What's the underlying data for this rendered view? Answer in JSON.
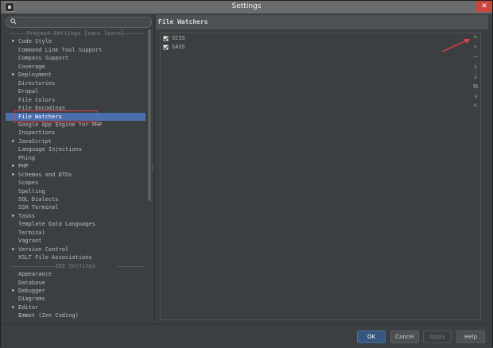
{
  "window": {
    "title": "Settings",
    "close_label": "✕"
  },
  "search": {
    "placeholder": ""
  },
  "tree": {
    "section_project": "Project Settings [sass learn]",
    "section_ide": "IDE Settings",
    "items": [
      {
        "label": "Code Style",
        "expandable": true
      },
      {
        "label": "Command Line Tool Support",
        "expandable": false
      },
      {
        "label": "Compass Support",
        "expandable": false
      },
      {
        "label": "Coverage",
        "expandable": false
      },
      {
        "label": "Deployment",
        "expandable": true
      },
      {
        "label": "Directories",
        "expandable": false
      },
      {
        "label": "Drupal",
        "expandable": false
      },
      {
        "label": "File Colors",
        "expandable": false
      },
      {
        "label": "File Encodings",
        "expandable": false
      },
      {
        "label": "File Watchers",
        "expandable": false,
        "selected": true
      },
      {
        "label": "Google App Engine for PHP",
        "expandable": false
      },
      {
        "label": "Inspections",
        "expandable": false
      },
      {
        "label": "JavaScript",
        "expandable": true
      },
      {
        "label": "Language Injections",
        "expandable": false
      },
      {
        "label": "Phing",
        "expandable": false
      },
      {
        "label": "PHP",
        "expandable": true
      },
      {
        "label": "Schemas and DTDs",
        "expandable": true
      },
      {
        "label": "Scopes",
        "expandable": false
      },
      {
        "label": "Spelling",
        "expandable": false
      },
      {
        "label": "SQL Dialects",
        "expandable": false
      },
      {
        "label": "SSH Terminal",
        "expandable": false
      },
      {
        "label": "Tasks",
        "expandable": true
      },
      {
        "label": "Template Data Languages",
        "expandable": false
      },
      {
        "label": "Terminal",
        "expandable": false
      },
      {
        "label": "Vagrant",
        "expandable": false
      },
      {
        "label": "Version Control",
        "expandable": true
      },
      {
        "label": "XSLT File Associations",
        "expandable": false
      }
    ],
    "ide_items": [
      {
        "label": "Appearance",
        "expandable": false
      },
      {
        "label": "Database",
        "expandable": false
      },
      {
        "label": "Debugger",
        "expandable": true
      },
      {
        "label": "Diagrams",
        "expandable": false
      },
      {
        "label": "Editor",
        "expandable": true
      },
      {
        "label": "Emmet (Zen Coding)",
        "expandable": false
      }
    ]
  },
  "panel": {
    "title": "File Watchers",
    "watchers": [
      {
        "label": "SCSS",
        "checked": true
      },
      {
        "label": "SASS",
        "checked": true
      }
    ]
  },
  "toolbar": {
    "add": "+",
    "edit": "✎",
    "remove": "−",
    "up": "↑",
    "down": "↓",
    "copy": "⧉",
    "import": "⇲",
    "export": "⇱"
  },
  "buttons": {
    "ok": "OK",
    "cancel": "Cancel",
    "apply": "Apply",
    "help": "Help"
  },
  "colors": {
    "selection": "#4b6eaf",
    "highlight_box": "#e0404a",
    "annotation_arrow": "#e0404a"
  }
}
